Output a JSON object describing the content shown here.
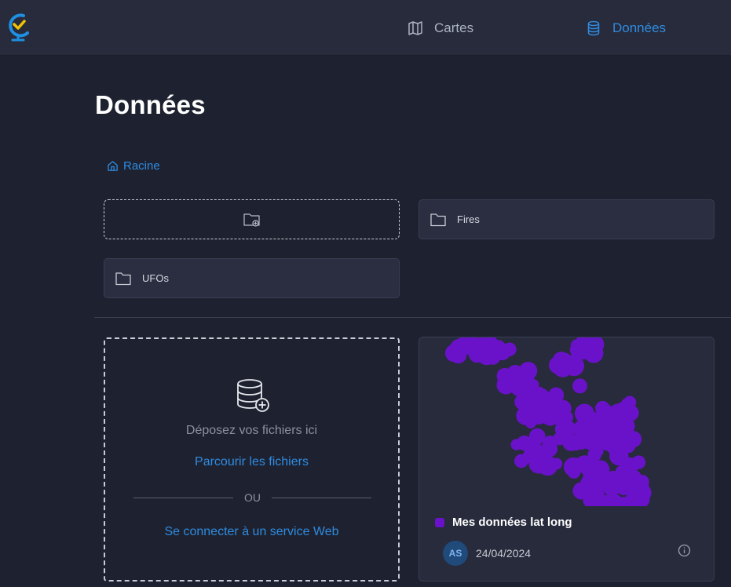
{
  "nav": {
    "cartes_label": "Cartes",
    "donnees_label": "Données",
    "active": "Données",
    "active_color": "#2f8be0",
    "icons": {
      "cartes": "map-icon",
      "donnees": "database-icon",
      "logo": "globe-check-logo"
    }
  },
  "page": {
    "title": "Données"
  },
  "breadcrumb": {
    "root_label": "Racine",
    "icon": "home-icon"
  },
  "folders": {
    "new_folder_icon": "folder-plus-icon",
    "items": [
      {
        "label": "Fires",
        "icon": "folder-icon"
      },
      {
        "label": "UFOs",
        "icon": "folder-icon"
      }
    ]
  },
  "dropzone": {
    "icon": "database-add-icon",
    "drop_text": "Déposez vos fichiers ici",
    "browse_label": "Parcourir les fichiers",
    "or_label": "OU",
    "connect_label": "Se connecter à un service Web"
  },
  "dataset": {
    "name": "Mes données lat long",
    "color": "#6a12c9",
    "owner_initials": "AS",
    "date": "24/04/2024",
    "info_icon": "info-icon"
  }
}
